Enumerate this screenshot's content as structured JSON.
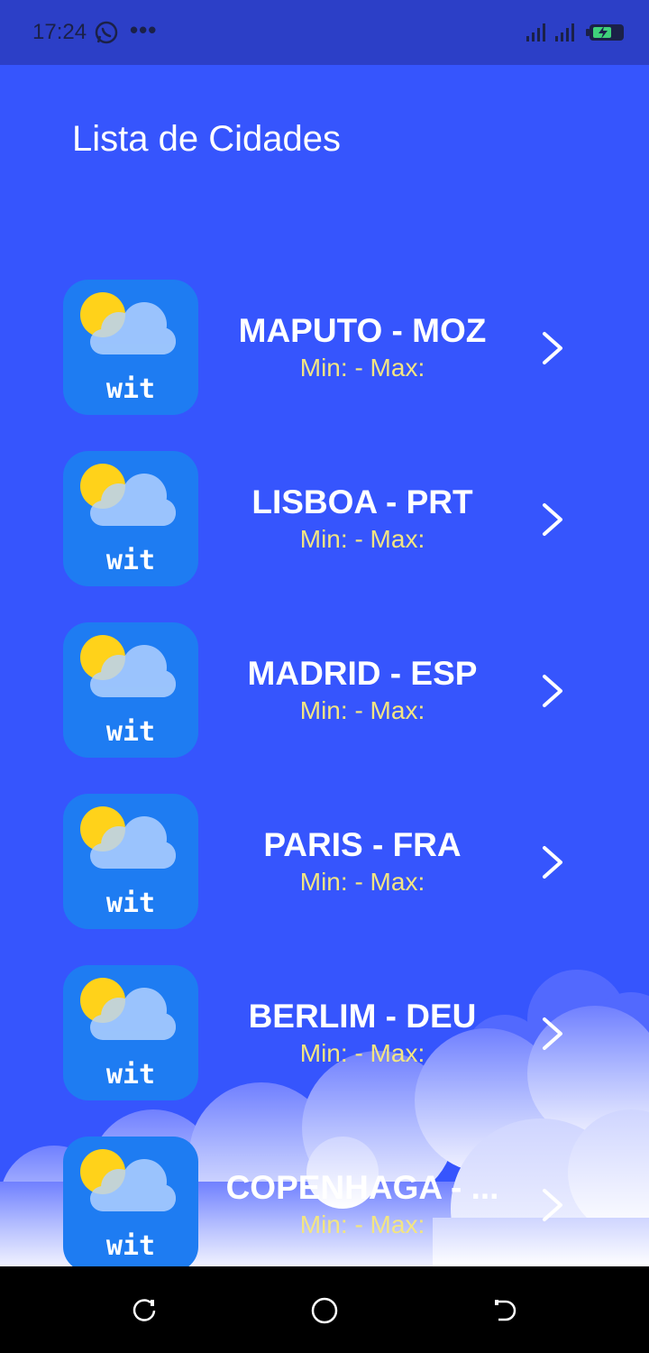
{
  "status_bar": {
    "time": "17:24",
    "icons": [
      "whatsapp-icon",
      "more-dots-icon",
      "signal-icon",
      "signal-icon",
      "battery-charging-icon"
    ]
  },
  "header": {
    "title": "Lista de Cidades"
  },
  "app_icon_label": "wit",
  "cities": [
    {
      "name": "MAPUTO - MOZ",
      "temps": "Min:  - Max:"
    },
    {
      "name": "LISBOA - PRT",
      "temps": "Min:  - Max:"
    },
    {
      "name": "MADRID - ESP",
      "temps": "Min:  - Max:"
    },
    {
      "name": "PARIS - FRA",
      "temps": "Min:  - Max:"
    },
    {
      "name": "BERLIM - DEU",
      "temps": "Min:  - Max:"
    },
    {
      "name": "COPENHAGA - ...",
      "temps": "Min:  - Max:"
    }
  ],
  "nav_bar": {
    "buttons": [
      "recent-apps-icon",
      "home-icon",
      "back-icon"
    ]
  },
  "colors": {
    "background": "#3655fd",
    "status_bar": "#2c3fc7",
    "icon_tile": "#1e7cf2",
    "sun": "#ffd21a",
    "temps_text": "#f3e582"
  }
}
